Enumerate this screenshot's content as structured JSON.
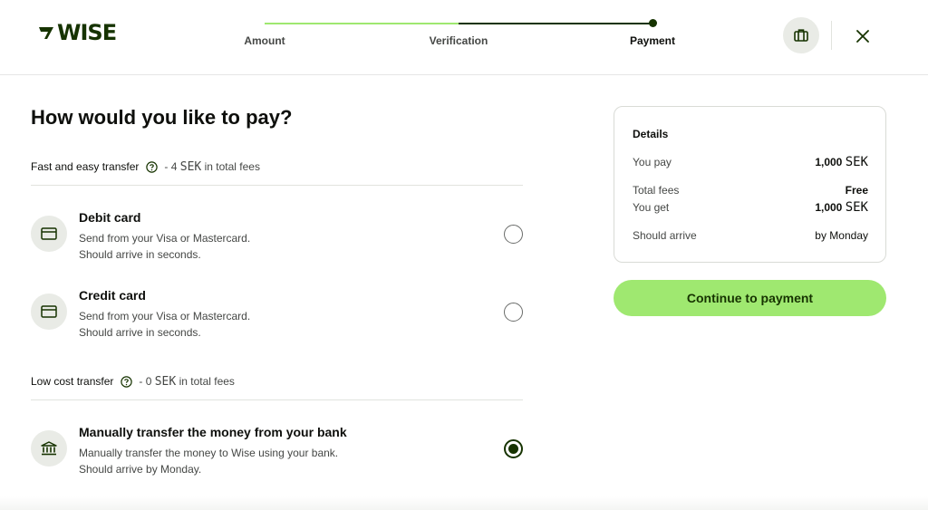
{
  "brand": {
    "logo_text": "WISE",
    "accent": "#9fe870",
    "dark": "#163300"
  },
  "stepper": {
    "steps": [
      {
        "label": "Amount"
      },
      {
        "label": "Verification"
      },
      {
        "label": "Payment"
      }
    ],
    "active_step": "Payment"
  },
  "header": {
    "briefcase_icon": "briefcase-icon",
    "close_icon": "close-icon"
  },
  "main": {
    "title": "How would you like to pay?",
    "sections": [
      {
        "label": "Fast and easy transfer",
        "fee_prefix": "- 4",
        "fee_currency": "SEK",
        "fee_suffix": "in total fees",
        "options": [
          {
            "title": "Debit card",
            "line1": "Send from your Visa or Mastercard.",
            "line2": "Should arrive in seconds.",
            "icon": "card-icon",
            "selected": false
          },
          {
            "title": "Credit card",
            "line1": "Send from your Visa or Mastercard.",
            "line2": "Should arrive in seconds.",
            "icon": "card-icon",
            "selected": false
          }
        ]
      },
      {
        "label": "Low cost transfer",
        "fee_prefix": "- 0",
        "fee_currency": "SEK",
        "fee_suffix": "in total fees",
        "options": [
          {
            "title": "Manually transfer the money from your bank",
            "line1": "Manually transfer the money to Wise using your bank.",
            "line2": "Should arrive by Monday.",
            "icon": "bank-icon",
            "selected": true
          }
        ]
      }
    ]
  },
  "details": {
    "title": "Details",
    "you_pay_label": "You pay",
    "you_pay_amount": "1,000",
    "you_pay_currency": "SEK",
    "total_fees_label": "Total fees",
    "total_fees_value": "Free",
    "you_get_label": "You get",
    "you_get_amount": "1,000",
    "you_get_currency": "SEK",
    "arrive_label": "Should arrive",
    "arrive_value": "by Monday"
  },
  "cta": {
    "label": "Continue to payment"
  }
}
